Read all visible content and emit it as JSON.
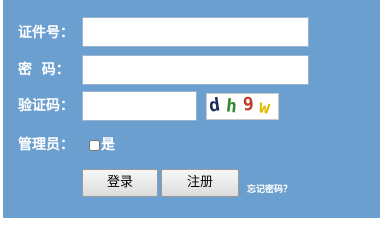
{
  "form": {
    "id_label": "证件号：",
    "id_value": "",
    "password_label": "密  码：",
    "password_value": "",
    "captcha_label": "验证码：",
    "captcha_value": "",
    "captcha_image_text": [
      "d",
      "h",
      "9",
      "w"
    ],
    "captcha_colors": [
      "#1b2a5a",
      "#2e8b2e",
      "#c0392b",
      "#e6b800"
    ],
    "admin_label": "管理员：",
    "admin_checkbox_label": "是",
    "admin_checked": false
  },
  "buttons": {
    "login_label": "登录",
    "register_label": "注册"
  },
  "links": {
    "forgot_password": "忘记密码？"
  }
}
